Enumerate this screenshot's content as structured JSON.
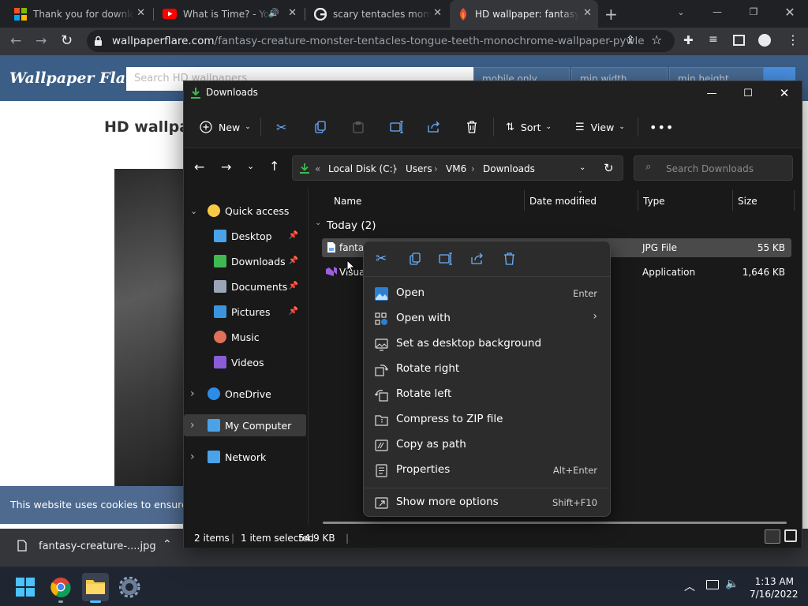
{
  "browser": {
    "tabs": [
      {
        "title": "Thank you for download",
        "icon": "microsoft-icon"
      },
      {
        "title": "What is Time? - You",
        "icon": "youtube-icon"
      },
      {
        "title": "scary tentacles monster",
        "icon": "google-icon"
      },
      {
        "title": "HD wallpaper: fantasy",
        "icon": "wallpaperflare-icon",
        "active": true
      }
    ],
    "url_host": "wallpaperflare.com",
    "url_path": "/fantasy-creature-monster-tentacles-tongue-teeth-monochrome-wallpaper-pywle"
  },
  "website": {
    "logo": "Wallpaper Flare",
    "search_placeholder": "Search HD wallpapers",
    "filter_mobile": "mobile only",
    "filter_min_width": "min width",
    "filter_min_height": "min height",
    "heading": "HD wallpap",
    "cookie_text": "This website uses cookies to ensure y"
  },
  "downloads_bar": {
    "file": "fantasy-creature-....jpg"
  },
  "explorer": {
    "title": "Downloads",
    "commands": {
      "new": "New",
      "sort": "Sort",
      "view": "View"
    },
    "breadcrumb": [
      "Local Disk (C:)",
      "Users",
      "VM6",
      "Downloads"
    ],
    "search_placeholder": "Search Downloads",
    "nav": [
      {
        "label": "Quick access",
        "icon": "star-icon",
        "pinned": false,
        "level": 0,
        "expanded": true
      },
      {
        "label": "Desktop",
        "icon": "desktop-icon",
        "pinned": true,
        "level": 1
      },
      {
        "label": "Downloads",
        "icon": "download-icon",
        "pinned": true,
        "level": 1
      },
      {
        "label": "Documents",
        "icon": "documents-icon",
        "pinned": true,
        "level": 1
      },
      {
        "label": "Pictures",
        "icon": "pictures-icon",
        "pinned": true,
        "level": 1
      },
      {
        "label": "Music",
        "icon": "music-icon",
        "pinned": false,
        "level": 1
      },
      {
        "label": "Videos",
        "icon": "videos-icon",
        "pinned": false,
        "level": 1
      },
      {
        "label": "OneDrive",
        "icon": "cloud-icon",
        "pinned": false,
        "level": 0
      },
      {
        "label": "My Computer",
        "icon": "computer-icon",
        "pinned": false,
        "level": 0,
        "selected": true
      },
      {
        "label": "Network",
        "icon": "network-icon",
        "pinned": false,
        "level": 0
      }
    ],
    "columns": {
      "name": "Name",
      "date": "Date modified",
      "type": "Type",
      "size": "Size"
    },
    "group": "Today (2)",
    "files": [
      {
        "name": "fantas",
        "type": "JPG File",
        "size": "55 KB",
        "selected": true
      },
      {
        "name": "Visua",
        "type": "Application",
        "size": "1,646 KB"
      }
    ],
    "status": {
      "items": "2 items",
      "selected": "1 item selected",
      "size": "54.9 KB"
    }
  },
  "context_menu": {
    "items": [
      {
        "label": "Open",
        "shortcut": "Enter",
        "icon": "image-icon"
      },
      {
        "label": "Open with",
        "shortcut": "",
        "icon": "apps-icon",
        "submenu": true
      },
      {
        "label": "Set as desktop background",
        "shortcut": "",
        "icon": "wallpaper-icon"
      },
      {
        "label": "Rotate right",
        "shortcut": "",
        "icon": "rotate-right-icon"
      },
      {
        "label": "Rotate left",
        "shortcut": "",
        "icon": "rotate-left-icon"
      },
      {
        "label": "Compress to ZIP file",
        "shortcut": "",
        "icon": "zip-icon"
      },
      {
        "label": "Copy as path",
        "shortcut": "",
        "icon": "copy-path-icon"
      },
      {
        "label": "Properties",
        "shortcut": "Alt+Enter",
        "icon": "properties-icon"
      }
    ],
    "more": {
      "label": "Show more options",
      "shortcut": "Shift+F10",
      "icon": "more-options-icon"
    }
  },
  "taskbar": {
    "time": "1:13 AM",
    "date": "7/16/2022"
  }
}
